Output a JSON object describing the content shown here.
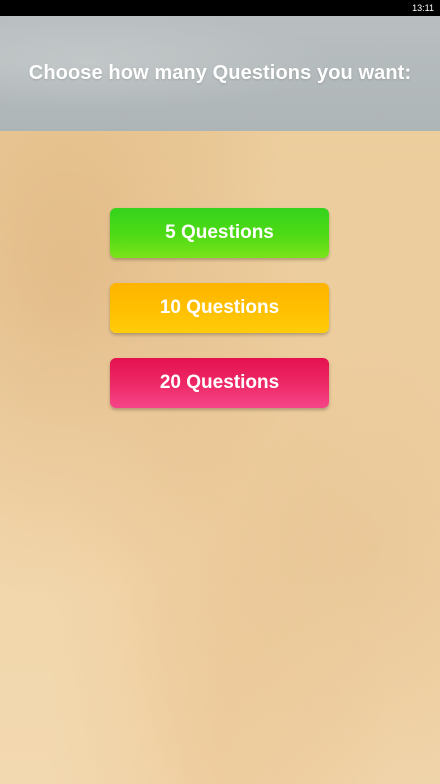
{
  "status_bar": {
    "time": "13:11"
  },
  "header": {
    "title": "Choose how many Questions you want:"
  },
  "options": [
    {
      "label": "5 Questions",
      "color": "#4fdb15"
    },
    {
      "label": "10 Questions",
      "color": "#ffbf00"
    },
    {
      "label": "20 Questions",
      "color": "#ee2a68"
    }
  ]
}
